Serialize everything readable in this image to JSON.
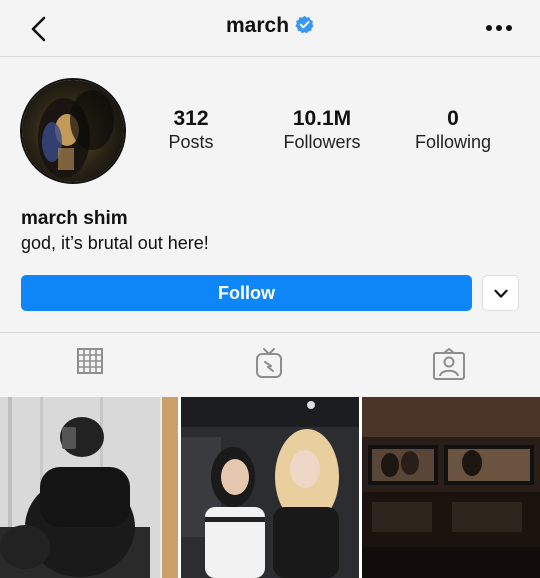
{
  "header": {
    "username": "march",
    "back_icon": "chevron-left-icon",
    "verified_icon": "verified-badge-icon",
    "more_icon": "more-horizontal-icon"
  },
  "profile": {
    "display_name": "march shim",
    "bio": "god, it’s brutal out here!",
    "stats": [
      {
        "value": "312",
        "label": "Posts"
      },
      {
        "value": "10.1M",
        "label": "Followers"
      },
      {
        "value": "0",
        "label": "Following"
      }
    ]
  },
  "actions": {
    "follow_label": "Follow",
    "dropdown_icon": "chevron-down-icon"
  },
  "tabs": [
    {
      "icon": "grid-icon",
      "active": true
    },
    {
      "icon": "igtv-icon",
      "active": false
    },
    {
      "icon": "tagged-icon",
      "active": false
    }
  ],
  "colors": {
    "accent": "#0f86f7",
    "verified": "#3897f0",
    "background": "#f4f4f4"
  },
  "posts": [
    {
      "description": "person in black taking mirror selfie"
    },
    {
      "description": "two people posing in a car"
    },
    {
      "description": "film monitors on a set"
    }
  ]
}
